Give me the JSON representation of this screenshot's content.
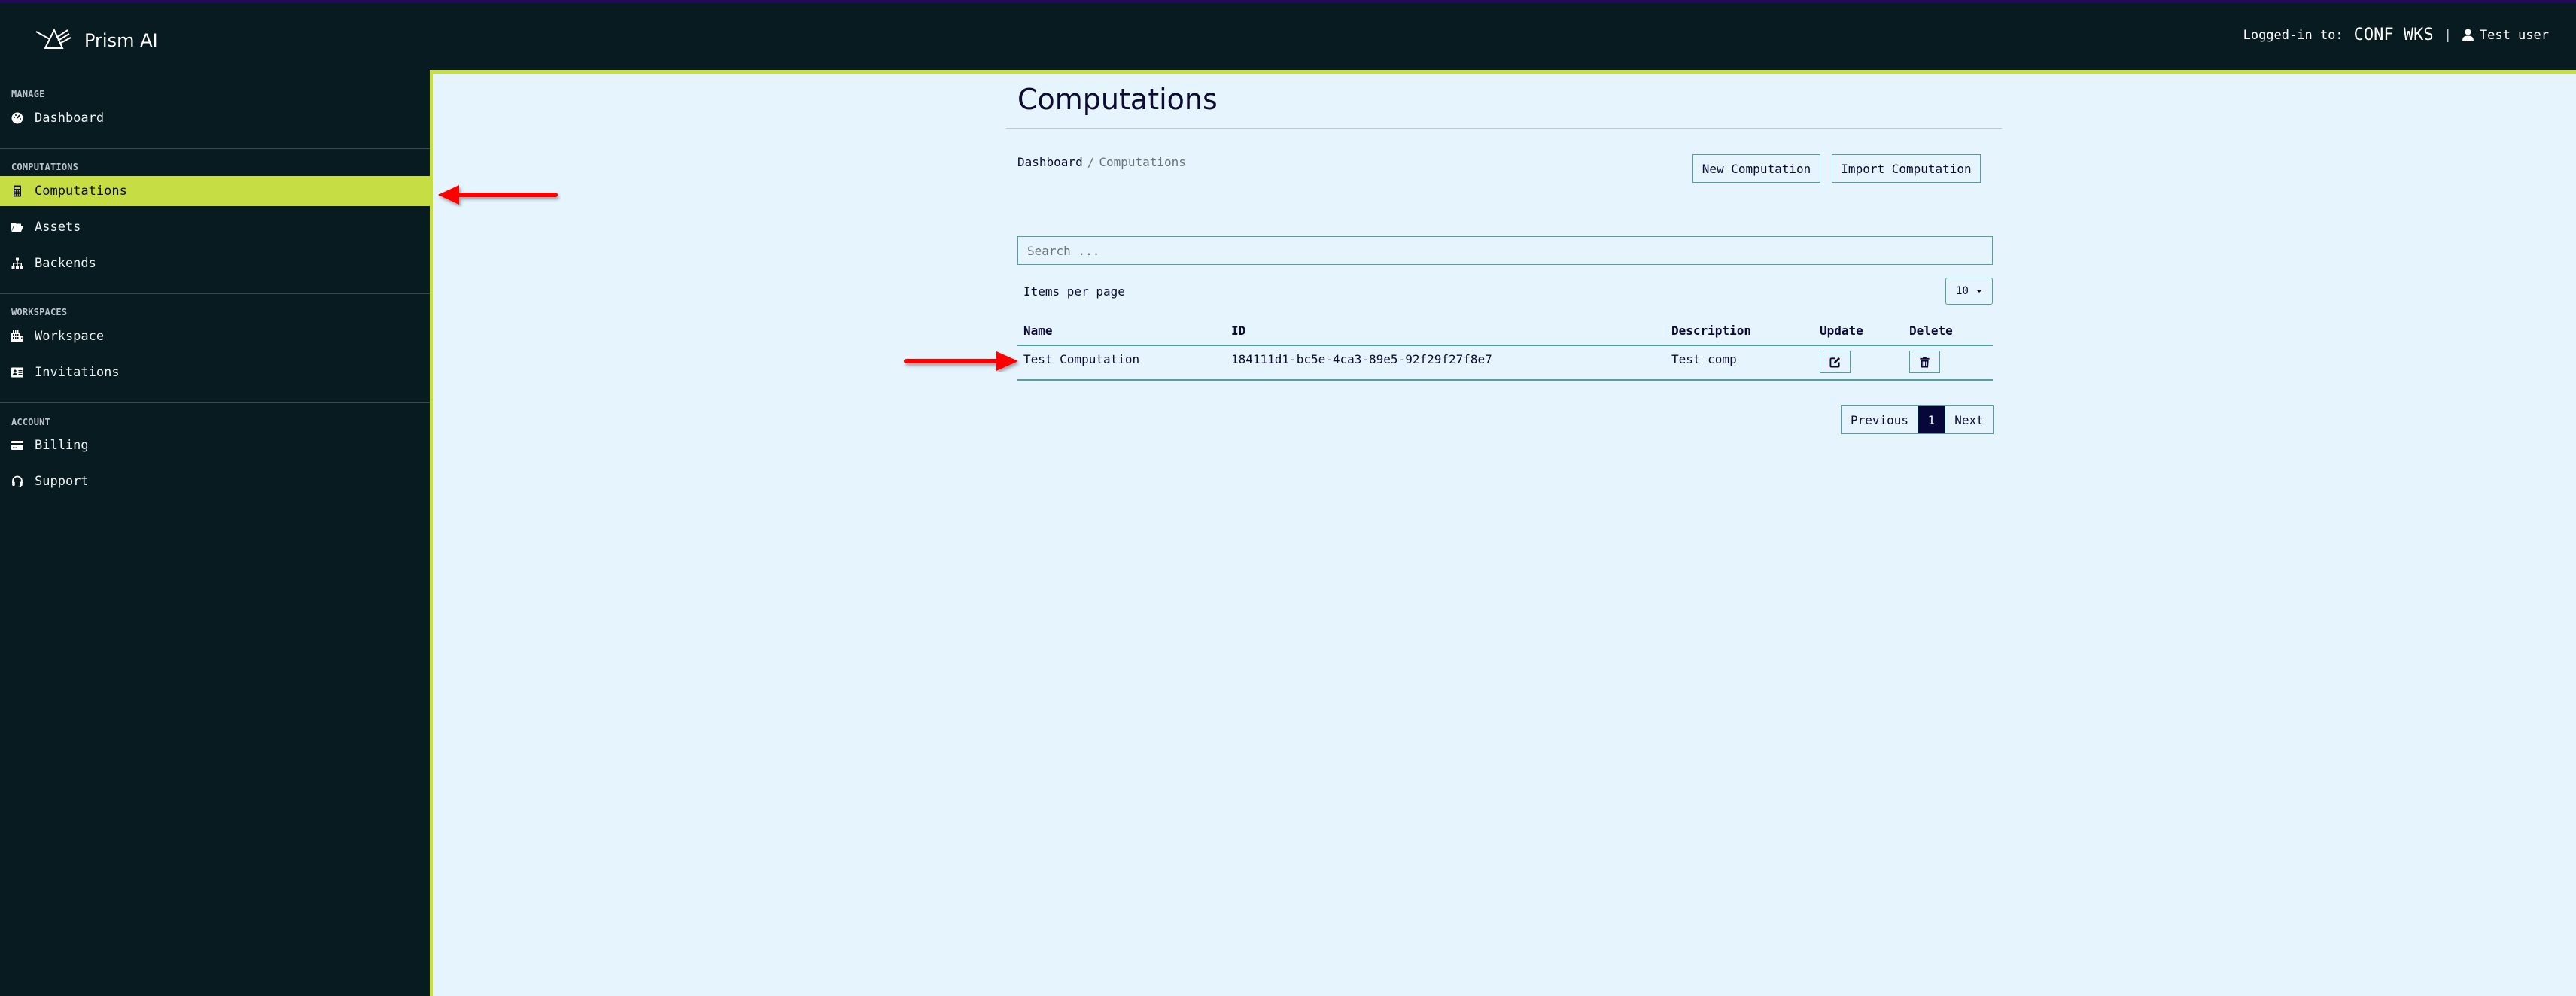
{
  "header": {
    "brand": "Prism AI",
    "logged_in_label": "Logged-in to:",
    "workspace": "CONF WKS",
    "separator": "|",
    "user": "Test user"
  },
  "sidebar": {
    "sections": [
      {
        "label": "MANAGE",
        "items": [
          {
            "label": "Dashboard",
            "icon": "tachometer-icon",
            "active": false
          }
        ]
      },
      {
        "label": "COMPUTATIONS",
        "items": [
          {
            "label": "Computations",
            "icon": "calculator-icon",
            "active": true
          },
          {
            "label": "Assets",
            "icon": "folder-open-icon",
            "active": false
          },
          {
            "label": "Backends",
            "icon": "sitemap-icon",
            "active": false
          }
        ]
      },
      {
        "label": "WORKSPACES",
        "items": [
          {
            "label": "Workspace",
            "icon": "building-icon",
            "active": false
          },
          {
            "label": "Invitations",
            "icon": "id-card-icon",
            "active": false
          }
        ]
      },
      {
        "label": "ACCOUNT",
        "items": [
          {
            "label": "Billing",
            "icon": "credit-card-icon",
            "active": false
          },
          {
            "label": "Support",
            "icon": "headset-icon",
            "active": false
          }
        ]
      }
    ]
  },
  "main": {
    "title": "Computations",
    "breadcrumb": {
      "parent": "Dashboard",
      "separator": "/",
      "current": "Computations"
    },
    "buttons": {
      "new": "New Computation",
      "import": "Import Computation"
    },
    "search": {
      "placeholder": "Search ...",
      "value": ""
    },
    "items_per_page": {
      "label": "Items per page",
      "value": "10"
    },
    "table": {
      "columns": [
        "Name",
        "ID",
        "Description",
        "Update",
        "Delete"
      ],
      "rows": [
        {
          "name": "Test Computation",
          "id": "184111d1-bc5e-4ca3-89e5-92f29f27f8e7",
          "description": "Test comp"
        }
      ]
    },
    "pagination": {
      "previous": "Previous",
      "current_page": "1",
      "next": "Next"
    }
  },
  "colors": {
    "accent": "#c6dd43",
    "sidebar_bg": "#081b21",
    "main_bg": "#e6f4fd",
    "border": "#4f9fa3",
    "text": "#0b0b33",
    "annotation_arrow": "#ff0000"
  }
}
